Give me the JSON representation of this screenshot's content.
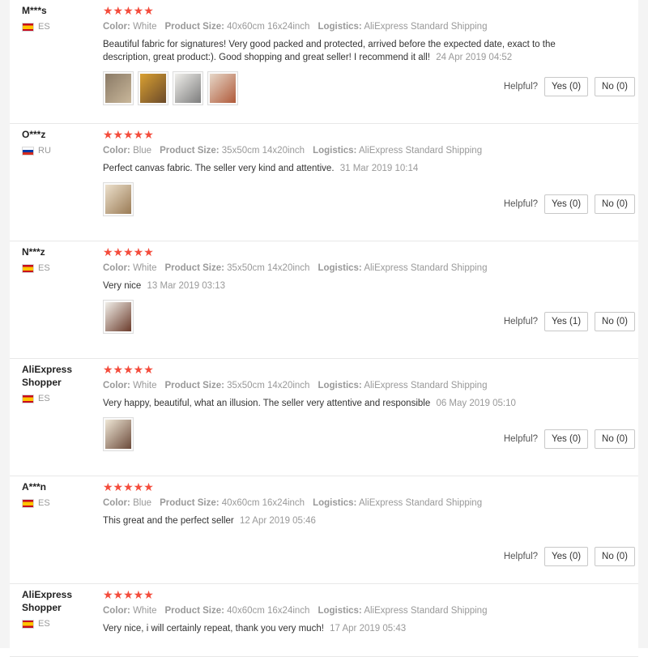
{
  "labels": {
    "color": "Color:",
    "product_size": "Product Size:",
    "logistics": "Logistics:",
    "helpful": "Helpful?"
  },
  "stars_text": "★★★★★",
  "accent_colors": {
    "stars": "#f44c3c",
    "date": "#999999"
  },
  "reviews": [
    {
      "user": "M***s",
      "country": "ES",
      "country_flag": "flag-es",
      "rating": 5,
      "color": "White",
      "size": "40x60cm 16x24inch",
      "logistics": "AliExpress Standard Shipping",
      "text": "Beautiful fabric for signatures! Very good packed and protected, arrived before the expected date, exact to the description, great product:). Good shopping and great seller! I recommend it all!",
      "date": "24 Apr 2019 04:52",
      "photos": [
        "photo-thumbnail",
        "photo-thumbnail",
        "photo-thumbnail",
        "photo-thumbnail"
      ],
      "yes": "Yes (0)",
      "no": "No (0)"
    },
    {
      "user": "O***z",
      "country": "RU",
      "country_flag": "flag-ru",
      "rating": 5,
      "color": "Blue",
      "size": "35x50cm 14x20inch",
      "logistics": "AliExpress Standard Shipping",
      "text": "Perfect canvas fabric. The seller very kind and attentive.",
      "date": "31 Mar 2019 10:14",
      "photos": [
        "photo-thumbnail"
      ],
      "yes": "Yes (0)",
      "no": "No (0)"
    },
    {
      "user": "N***z",
      "country": "ES",
      "country_flag": "flag-es",
      "rating": 5,
      "color": "White",
      "size": "35x50cm 14x20inch",
      "logistics": "AliExpress Standard Shipping",
      "text": "Very nice",
      "date": "13 Mar 2019 03:13",
      "photos": [
        "photo-thumbnail"
      ],
      "yes": "Yes (1)",
      "no": "No (0)"
    },
    {
      "user": "AliExpress Shopper",
      "country": "ES",
      "country_flag": "flag-es",
      "rating": 5,
      "color": "White",
      "size": "35x50cm 14x20inch",
      "logistics": "AliExpress Standard Shipping",
      "text": "Very happy, beautiful, what an illusion. The seller very attentive and responsible",
      "date": "06 May 2019 05:10",
      "photos": [
        "photo-thumbnail"
      ],
      "yes": "Yes (0)",
      "no": "No (0)"
    },
    {
      "user": "A***n",
      "country": "ES",
      "country_flag": "flag-es",
      "rating": 5,
      "color": "Blue",
      "size": "40x60cm 16x24inch",
      "logistics": "AliExpress Standard Shipping",
      "text": "This great and the perfect seller",
      "date": "12 Apr 2019 05:46",
      "photos": [],
      "yes": "Yes (0)",
      "no": "No (0)"
    },
    {
      "user": "AliExpress Shopper",
      "country": "ES",
      "country_flag": "flag-es",
      "rating": 5,
      "color": "White",
      "size": "40x60cm 16x24inch",
      "logistics": "AliExpress Standard Shipping",
      "text": "Very nice, i will certainly repeat, thank you very much!",
      "date": "17 Apr 2019 05:43",
      "photos": [],
      "yes": "",
      "no": ""
    }
  ]
}
